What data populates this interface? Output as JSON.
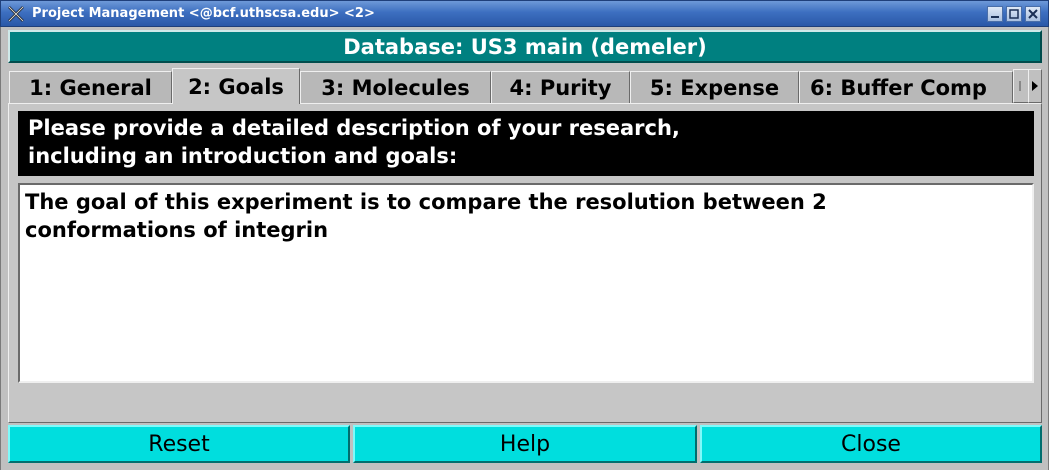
{
  "window": {
    "title": "Project Management <@bcf.uthscsa.edu> <2>",
    "controls": [
      "minimize-icon",
      "maximize-icon",
      "close-icon"
    ]
  },
  "header": {
    "database_label": "Database: US3 main (demeler)"
  },
  "tabs": [
    {
      "label": "1: General",
      "active": false
    },
    {
      "label": "2: Goals",
      "active": true
    },
    {
      "label": "3: Molecules",
      "active": false
    },
    {
      "label": "4: Purity",
      "active": false
    },
    {
      "label": "5: Expense",
      "active": false
    },
    {
      "label": "6: Buffer Comp",
      "active": false
    }
  ],
  "goals": {
    "prompt_lines": [
      "Please provide a detailed description of your research,",
      "including an introduction and goals:"
    ],
    "text_lines": [
      "The goal of this experiment is to compare the resolution between 2",
      "conformations of integrin"
    ]
  },
  "buttons": {
    "reset": "Reset",
    "help": "Help",
    "close": "Close"
  },
  "colors": {
    "banner": "#008080",
    "button": "#00dede",
    "titlebar": "#3d6fc0"
  }
}
